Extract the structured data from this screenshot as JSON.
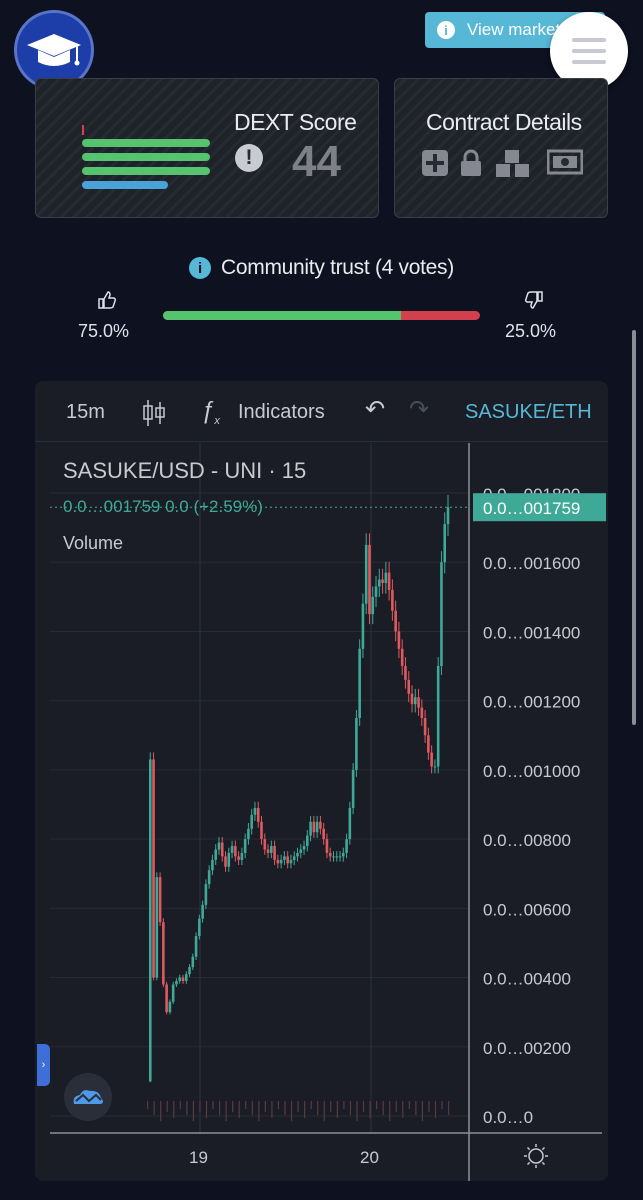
{
  "header": {
    "view_market_label": "View market",
    "colors": {
      "accent": "#56b8d6",
      "logo_bg": "#1d3ea8"
    }
  },
  "dext": {
    "title": "DEXT Score",
    "score": "44",
    "bars": [
      {
        "level": 0.8,
        "color": "#56c46f"
      },
      {
        "level": 0.8,
        "color": "#56c46f"
      },
      {
        "level": 0.8,
        "color": "#56c46f"
      },
      {
        "level": 0.54,
        "color": "#4aa3d8"
      }
    ]
  },
  "contract": {
    "title": "Contract Details",
    "icons": [
      "plus-box-icon",
      "lock-icon",
      "cubes-icon",
      "money-icon"
    ]
  },
  "community": {
    "label": "Community trust (4 votes)",
    "up_pct": "75.0%",
    "down_pct": "25.0%",
    "up_fraction": 0.75,
    "colors": {
      "up": "#56c46f",
      "down": "#d3404d"
    }
  },
  "chart_toolbar": {
    "interval": "15m",
    "indicators": "Indicators",
    "pair": "SASUKE/ETH"
  },
  "chart_data": {
    "type": "candlestick",
    "title": "SASUKE/USD - UNI",
    "interval_label": "15",
    "last_label": "0.0…001759",
    "ohlc_label": "0.0…001759  0.0 (+2.59%)",
    "volume_label": "Volume",
    "y_tick_labels": [
      "0.0…001800",
      "0.0…001600",
      "0.0…001400",
      "0.0…001200",
      "0.0…001000",
      "0.0…00800",
      "0.0…00600",
      "0.0…00400",
      "0.0…00200",
      "0.0…0"
    ],
    "y_tick_values": [
      0.0018,
      0.0016,
      0.0014,
      0.0012,
      0.001,
      0.0008,
      0.0006,
      0.0004,
      0.0002,
      0
    ],
    "x_tick_labels": [
      "19",
      "20"
    ],
    "ylim": [
      0,
      0.0018
    ],
    "up_color": "#3fa997",
    "down_color": "#e0595f",
    "closes": [
      0.0001,
      0.00103,
      0.0004,
      0.00069,
      0.00056,
      0.00038,
      0.0003,
      0.00033,
      0.00038,
      0.00039,
      0.0004,
      0.00039,
      0.00041,
      0.00043,
      0.00046,
      0.00052,
      0.00057,
      0.00061,
      0.00067,
      0.00071,
      0.00074,
      0.00077,
      0.00079,
      0.00075,
      0.00072,
      0.00076,
      0.00078,
      0.00075,
      0.00074,
      0.00076,
      0.0008,
      0.00083,
      0.00087,
      0.00089,
      0.00085,
      0.0008,
      0.00077,
      0.00076,
      0.00078,
      0.00074,
      0.00073,
      0.00074,
      0.00075,
      0.00073,
      0.00074,
      0.00075,
      0.00076,
      0.00077,
      0.00078,
      0.00081,
      0.00085,
      0.00082,
      0.00085,
      0.00083,
      0.0008,
      0.00076,
      0.00075,
      0.00075,
      0.00075,
      0.00075,
      0.00076,
      0.0008,
      0.00089,
      0.001,
      0.00115,
      0.00135,
      0.00148,
      0.00165,
      0.00145,
      0.0015,
      0.00153,
      0.00155,
      0.00154,
      0.00157,
      0.00152,
      0.00146,
      0.0014,
      0.00135,
      0.0013,
      0.00126,
      0.00122,
      0.00119,
      0.00121,
      0.00118,
      0.00115,
      0.0011,
      0.00105,
      0.00101,
      0.00101,
      0.0013,
      0.0016,
      0.00171,
      0.001759
    ]
  }
}
